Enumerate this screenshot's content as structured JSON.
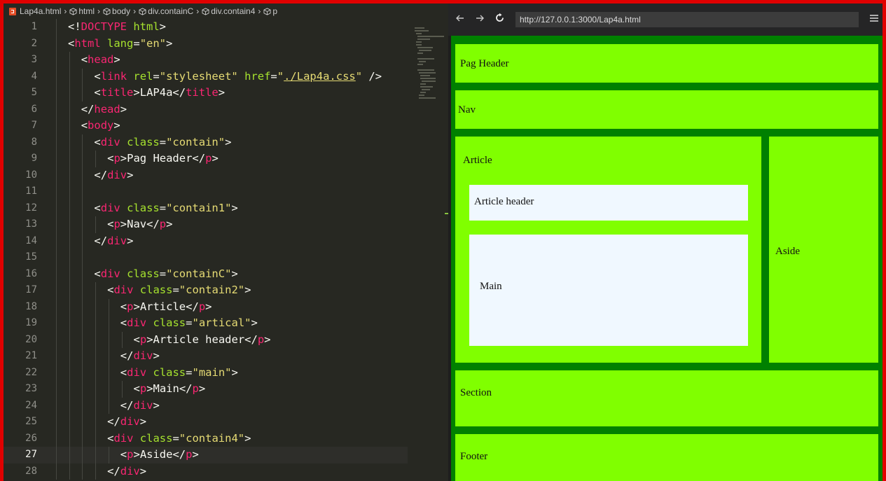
{
  "editor": {
    "breadcrumbs": [
      "Lap4a.html",
      "html",
      "body",
      "div.containC",
      "div.contain4",
      "p"
    ],
    "active_line": 27,
    "lines": [
      {
        "n": "1",
        "indent": 0,
        "tokens": [
          {
            "c": "t-p",
            "t": "<!"
          },
          {
            "c": "t-doc",
            "t": "DOCTYPE"
          },
          {
            "c": "t-p",
            "t": " "
          },
          {
            "c": "t-attr",
            "t": "html"
          },
          {
            "c": "t-p",
            "t": ">"
          }
        ]
      },
      {
        "n": "2",
        "indent": 0,
        "tokens": [
          {
            "c": "t-p",
            "t": "<"
          },
          {
            "c": "t-tag",
            "t": "html"
          },
          {
            "c": "t-p",
            "t": " "
          },
          {
            "c": "t-attr",
            "t": "lang"
          },
          {
            "c": "t-p",
            "t": "="
          },
          {
            "c": "t-str",
            "t": "\"en\""
          },
          {
            "c": "t-p",
            "t": ">"
          }
        ]
      },
      {
        "n": "3",
        "indent": 1,
        "tokens": [
          {
            "c": "t-p",
            "t": "<"
          },
          {
            "c": "t-tag",
            "t": "head"
          },
          {
            "c": "t-p",
            "t": ">"
          }
        ]
      },
      {
        "n": "4",
        "indent": 2,
        "tokens": [
          {
            "c": "t-p",
            "t": "<"
          },
          {
            "c": "t-tag",
            "t": "link"
          },
          {
            "c": "t-p",
            "t": " "
          },
          {
            "c": "t-attr",
            "t": "rel"
          },
          {
            "c": "t-p",
            "t": "="
          },
          {
            "c": "t-str",
            "t": "\"stylesheet\""
          },
          {
            "c": "t-p",
            "t": " "
          },
          {
            "c": "t-attr",
            "t": "href"
          },
          {
            "c": "t-p",
            "t": "="
          },
          {
            "c": "t-str",
            "t": "\""
          },
          {
            "c": "t-link",
            "t": "./Lap4a.css"
          },
          {
            "c": "t-str",
            "t": "\""
          },
          {
            "c": "t-p",
            "t": " />"
          }
        ]
      },
      {
        "n": "5",
        "indent": 2,
        "tokens": [
          {
            "c": "t-p",
            "t": "<"
          },
          {
            "c": "t-tag",
            "t": "title"
          },
          {
            "c": "t-p",
            "t": ">LAP4a</"
          },
          {
            "c": "t-tag",
            "t": "title"
          },
          {
            "c": "t-p",
            "t": ">"
          }
        ]
      },
      {
        "n": "6",
        "indent": 1,
        "tokens": [
          {
            "c": "t-p",
            "t": "</"
          },
          {
            "c": "t-tag",
            "t": "head"
          },
          {
            "c": "t-p",
            "t": ">"
          }
        ]
      },
      {
        "n": "7",
        "indent": 1,
        "tokens": [
          {
            "c": "t-p",
            "t": "<"
          },
          {
            "c": "t-tag",
            "t": "body"
          },
          {
            "c": "t-p",
            "t": ">"
          }
        ]
      },
      {
        "n": "8",
        "indent": 2,
        "tokens": [
          {
            "c": "t-p",
            "t": "<"
          },
          {
            "c": "t-tag",
            "t": "div"
          },
          {
            "c": "t-p",
            "t": " "
          },
          {
            "c": "t-attr",
            "t": "class"
          },
          {
            "c": "t-p",
            "t": "="
          },
          {
            "c": "t-str",
            "t": "\"contain\""
          },
          {
            "c": "t-p",
            "t": ">"
          }
        ]
      },
      {
        "n": "9",
        "indent": 3,
        "tokens": [
          {
            "c": "t-p",
            "t": "<"
          },
          {
            "c": "t-tag",
            "t": "p"
          },
          {
            "c": "t-p",
            "t": ">Pag Header</"
          },
          {
            "c": "t-tag",
            "t": "p"
          },
          {
            "c": "t-p",
            "t": ">"
          }
        ]
      },
      {
        "n": "10",
        "indent": 2,
        "tokens": [
          {
            "c": "t-p",
            "t": "</"
          },
          {
            "c": "t-tag",
            "t": "div"
          },
          {
            "c": "t-p",
            "t": ">"
          }
        ]
      },
      {
        "n": "11",
        "indent": 2,
        "tokens": []
      },
      {
        "n": "12",
        "indent": 2,
        "tokens": [
          {
            "c": "t-p",
            "t": "<"
          },
          {
            "c": "t-tag",
            "t": "div"
          },
          {
            "c": "t-p",
            "t": " "
          },
          {
            "c": "t-attr",
            "t": "class"
          },
          {
            "c": "t-p",
            "t": "="
          },
          {
            "c": "t-str",
            "t": "\"contain1\""
          },
          {
            "c": "t-p",
            "t": ">"
          }
        ]
      },
      {
        "n": "13",
        "indent": 3,
        "tokens": [
          {
            "c": "t-p",
            "t": "<"
          },
          {
            "c": "t-tag",
            "t": "p"
          },
          {
            "c": "t-p",
            "t": ">Nav</"
          },
          {
            "c": "t-tag",
            "t": "p"
          },
          {
            "c": "t-p",
            "t": ">"
          }
        ]
      },
      {
        "n": "14",
        "indent": 2,
        "tokens": [
          {
            "c": "t-p",
            "t": "</"
          },
          {
            "c": "t-tag",
            "t": "div"
          },
          {
            "c": "t-p",
            "t": ">"
          }
        ]
      },
      {
        "n": "15",
        "indent": 2,
        "tokens": []
      },
      {
        "n": "16",
        "indent": 2,
        "tokens": [
          {
            "c": "t-p",
            "t": "<"
          },
          {
            "c": "t-tag",
            "t": "div"
          },
          {
            "c": "t-p",
            "t": " "
          },
          {
            "c": "t-attr",
            "t": "class"
          },
          {
            "c": "t-p",
            "t": "="
          },
          {
            "c": "t-str",
            "t": "\"containC\""
          },
          {
            "c": "t-p",
            "t": ">"
          }
        ]
      },
      {
        "n": "17",
        "indent": 3,
        "tokens": [
          {
            "c": "t-p",
            "t": "<"
          },
          {
            "c": "t-tag",
            "t": "div"
          },
          {
            "c": "t-p",
            "t": " "
          },
          {
            "c": "t-attr",
            "t": "class"
          },
          {
            "c": "t-p",
            "t": "="
          },
          {
            "c": "t-str",
            "t": "\"contain2\""
          },
          {
            "c": "t-p",
            "t": ">"
          }
        ]
      },
      {
        "n": "18",
        "indent": 4,
        "tokens": [
          {
            "c": "t-p",
            "t": "<"
          },
          {
            "c": "t-tag",
            "t": "p"
          },
          {
            "c": "t-p",
            "t": ">Article</"
          },
          {
            "c": "t-tag",
            "t": "p"
          },
          {
            "c": "t-p",
            "t": ">"
          }
        ]
      },
      {
        "n": "19",
        "indent": 4,
        "tokens": [
          {
            "c": "t-p",
            "t": "<"
          },
          {
            "c": "t-tag",
            "t": "div"
          },
          {
            "c": "t-p",
            "t": " "
          },
          {
            "c": "t-attr",
            "t": "class"
          },
          {
            "c": "t-p",
            "t": "="
          },
          {
            "c": "t-str",
            "t": "\"artical\""
          },
          {
            "c": "t-p",
            "t": ">"
          }
        ]
      },
      {
        "n": "20",
        "indent": 5,
        "tokens": [
          {
            "c": "t-p",
            "t": "<"
          },
          {
            "c": "t-tag",
            "t": "p"
          },
          {
            "c": "t-p",
            "t": ">Article header</"
          },
          {
            "c": "t-tag",
            "t": "p"
          },
          {
            "c": "t-p",
            "t": ">"
          }
        ]
      },
      {
        "n": "21",
        "indent": 4,
        "tokens": [
          {
            "c": "t-p",
            "t": "</"
          },
          {
            "c": "t-tag",
            "t": "div"
          },
          {
            "c": "t-p",
            "t": ">"
          }
        ]
      },
      {
        "n": "22",
        "indent": 4,
        "tokens": [
          {
            "c": "t-p",
            "t": "<"
          },
          {
            "c": "t-tag",
            "t": "div"
          },
          {
            "c": "t-p",
            "t": " "
          },
          {
            "c": "t-attr",
            "t": "class"
          },
          {
            "c": "t-p",
            "t": "="
          },
          {
            "c": "t-str",
            "t": "\"main\""
          },
          {
            "c": "t-p",
            "t": ">"
          }
        ]
      },
      {
        "n": "23",
        "indent": 5,
        "tokens": [
          {
            "c": "t-p",
            "t": "<"
          },
          {
            "c": "t-tag",
            "t": "p"
          },
          {
            "c": "t-p",
            "t": ">Main</"
          },
          {
            "c": "t-tag",
            "t": "p"
          },
          {
            "c": "t-p",
            "t": ">"
          }
        ]
      },
      {
        "n": "24",
        "indent": 4,
        "tokens": [
          {
            "c": "t-p",
            "t": "</"
          },
          {
            "c": "t-tag",
            "t": "div"
          },
          {
            "c": "t-p",
            "t": ">"
          }
        ]
      },
      {
        "n": "25",
        "indent": 3,
        "tokens": [
          {
            "c": "t-p",
            "t": "</"
          },
          {
            "c": "t-tag",
            "t": "div"
          },
          {
            "c": "t-p",
            "t": ">"
          }
        ]
      },
      {
        "n": "26",
        "indent": 3,
        "tokens": [
          {
            "c": "t-p",
            "t": "<"
          },
          {
            "c": "t-tag",
            "t": "div"
          },
          {
            "c": "t-p",
            "t": " "
          },
          {
            "c": "t-attr",
            "t": "class"
          },
          {
            "c": "t-p",
            "t": "="
          },
          {
            "c": "t-str",
            "t": "\"contain4\""
          },
          {
            "c": "t-p",
            "t": ">"
          }
        ]
      },
      {
        "n": "27",
        "indent": 4,
        "tokens": [
          {
            "c": "t-p",
            "t": "<"
          },
          {
            "c": "t-tag",
            "t": "p"
          },
          {
            "c": "t-p",
            "t": ">Aside</"
          },
          {
            "c": "t-tag",
            "t": "p"
          },
          {
            "c": "t-p",
            "t": ">"
          }
        ]
      },
      {
        "n": "28",
        "indent": 3,
        "tokens": [
          {
            "c": "t-p",
            "t": "</"
          },
          {
            "c": "t-tag",
            "t": "div"
          },
          {
            "c": "t-p",
            "t": ">"
          }
        ]
      }
    ]
  },
  "browser": {
    "url": "http://127.0.0.1:3000/Lap4a.html",
    "back_icon": "arrow-left-icon",
    "forward_icon": "arrow-right-icon",
    "reload_icon": "reload-icon",
    "menu_icon": "hamburger-menu-icon"
  },
  "preview": {
    "header": "Pag Header",
    "nav": "Nav",
    "article": "Article",
    "article_header": "Article header",
    "main": "Main",
    "aside": "Aside",
    "section": "Section",
    "footer": "Footer"
  },
  "colors": {
    "frame_border": "#e00000",
    "page_background": "#008000",
    "box_background": "#80ff00",
    "inner_background": "#f0f8ff"
  }
}
